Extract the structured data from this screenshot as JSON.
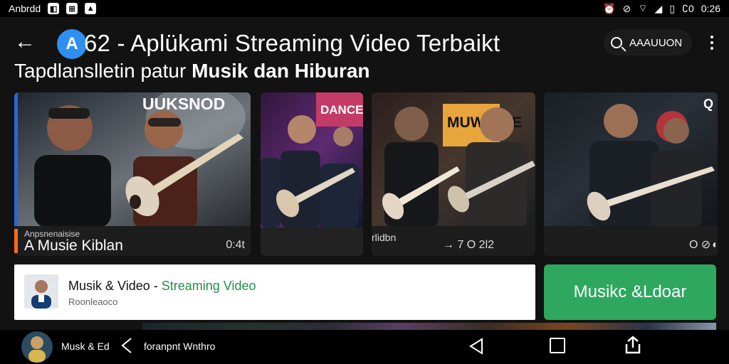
{
  "status_bar": {
    "carrier": "Anbrdd",
    "left_icons": [
      "app-icon-1",
      "app-icon-2",
      "app-icon-3"
    ],
    "right_icons": [
      "alarm-icon",
      "mute-icon",
      "wifi-icon",
      "signal-icon",
      "battery-icon"
    ],
    "time": "0:26",
    "battery": "∁0"
  },
  "app_bar": {
    "logo_text": "A",
    "title": "62 - Aplükami Streaming Video Terbaikt",
    "search_label": "AAAUUON",
    "back_icon": "back-arrow-icon",
    "search_icon": "search-icon",
    "more_icon": "more-vertical-icon"
  },
  "subtitle": {
    "prefix": "Tapdlanslletin patur",
    "strong": "Musik dan Hiburan"
  },
  "cards": [
    {
      "overlay_text": "UUKSNOD",
      "kicker": "Anpsnenaisise",
      "title": "A Musie Kiblan",
      "time": "0:4t"
    },
    {
      "overlay_text": "DANCE"
    },
    {
      "overlay_text": "MUW MUE",
      "left_label": "rlidbn",
      "right_label": "→   7   O 2l2"
    },
    {
      "overlay_text": "Q",
      "right_label": "O ⊘◖"
    }
  ],
  "info_panel": {
    "title": "Musik & Video",
    "separator": " - ",
    "highlight": "Streaming Video",
    "subtitle": "Roonleaoco"
  },
  "action_button": {
    "label": "Musikc &Ldoar"
  },
  "nav_bar": {
    "label_1": "Musk & Ed",
    "label_2": "foranpnt Wnthro"
  },
  "colors": {
    "background": "#121212",
    "status_bar": "#000000",
    "accent_blue": "#2f8ff0",
    "accent_orange": "#ff6a1a",
    "green_button": "#2ea85f",
    "green_text": "#1f8f4a"
  }
}
